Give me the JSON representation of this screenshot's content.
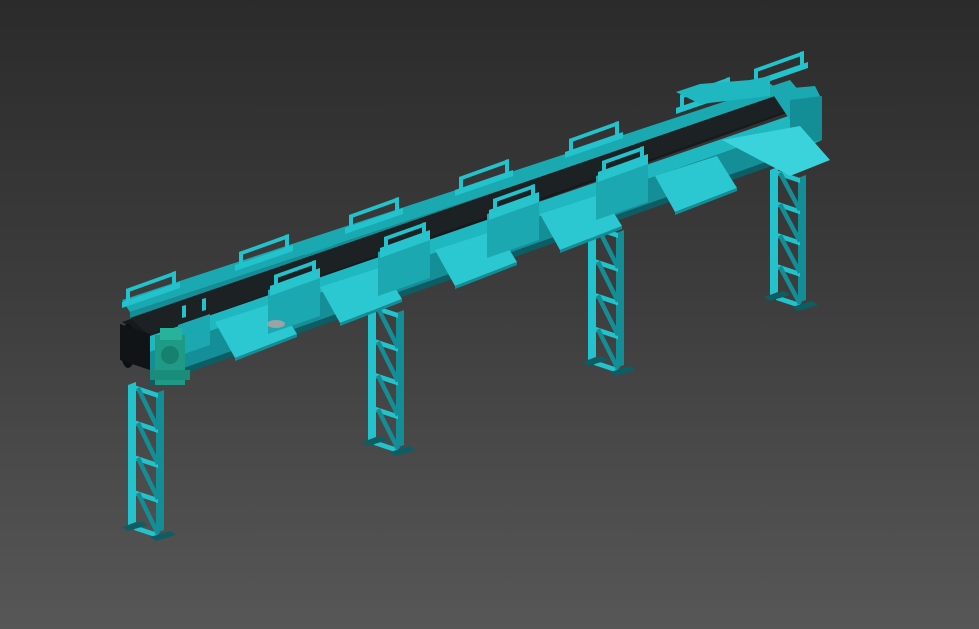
{
  "viewport": {
    "name": "3d-viewport",
    "render_mode": "shaded"
  },
  "model": {
    "object": "belt-conveyor",
    "colors": {
      "frame": "#22c3cc",
      "frame_dark": "#138e96",
      "frame_shadow": "#0c5e64",
      "belt": "#161a1c",
      "belt_edge": "#0a0c0d",
      "motor": "#1f9a86",
      "background_top": "#2b2b2b",
      "background_bottom": "#575757"
    }
  }
}
